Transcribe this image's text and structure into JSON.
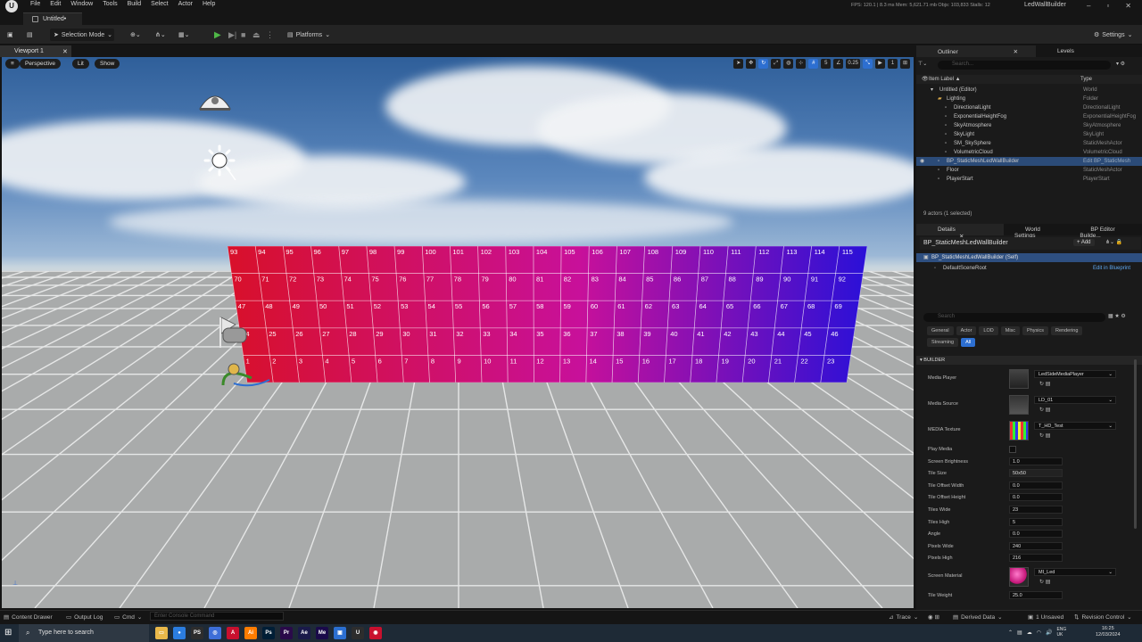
{
  "menubar": {
    "items": [
      "File",
      "Edit",
      "Window",
      "Tools",
      "Build",
      "Select",
      "Actor",
      "Help"
    ],
    "stats": "FPS: 120.1  |  8.3 ms  Mem: 5,621.71 mb  Objs: 103,833  Stalls: 12",
    "project": "LedWallBuilder",
    "logo": "U"
  },
  "tab": {
    "title": "Untitled•"
  },
  "toolbar": {
    "selection_mode": "Selection Mode",
    "platforms": "Platforms",
    "settings": "Settings"
  },
  "viewport": {
    "tab": "Viewport 1",
    "perspective": "Perspective",
    "lit": "Lit",
    "show": "Show",
    "grid_size": "5",
    "angle": "0.25",
    "cam_speed": "1"
  },
  "ledwall": {
    "rows": [
      [
        93,
        94,
        95,
        96,
        97,
        98,
        99,
        100,
        101,
        102,
        103,
        104,
        105,
        106,
        107,
        108,
        109,
        110,
        111,
        112,
        113,
        114,
        115
      ],
      [
        70,
        71,
        72,
        73,
        74,
        75,
        76,
        77,
        78,
        79,
        80,
        81,
        82,
        83,
        84,
        85,
        86,
        87,
        88,
        89,
        90,
        91,
        92
      ],
      [
        47,
        48,
        49,
        50,
        51,
        52,
        53,
        54,
        55,
        56,
        57,
        58,
        59,
        60,
        61,
        62,
        63,
        64,
        65,
        66,
        67,
        68,
        69
      ],
      [
        24,
        25,
        26,
        27,
        28,
        29,
        30,
        31,
        32,
        33,
        34,
        35,
        36,
        37,
        38,
        39,
        40,
        41,
        42,
        43,
        44,
        45,
        46
      ],
      [
        1,
        2,
        3,
        4,
        5,
        6,
        7,
        8,
        9,
        10,
        11,
        12,
        13,
        14,
        15,
        16,
        17,
        18,
        19,
        20,
        21,
        22,
        23
      ]
    ],
    "color_left": "#d8102a",
    "color_mid": "#c8109a",
    "color_right": "#2a10d8"
  },
  "outliner": {
    "tab": "Outliner",
    "tab2": "Levels",
    "search": "Search...",
    "col_label": "Item Label ▲",
    "col_type": "Type",
    "items": [
      {
        "label": "Untitled (Editor)",
        "type": "World",
        "indent": 0
      },
      {
        "label": "Lighting",
        "type": "Folder",
        "indent": 1
      },
      {
        "label": "DirectionalLight",
        "type": "DirectionalLight",
        "indent": 2
      },
      {
        "label": "ExponentialHeightFog",
        "type": "ExponentialHeightFog",
        "indent": 2
      },
      {
        "label": "SkyAtmosphere",
        "type": "SkyAtmosphere",
        "indent": 2
      },
      {
        "label": "SkyLight",
        "type": "SkyLight",
        "indent": 2
      },
      {
        "label": "SM_SkySphere",
        "type": "StaticMeshActor",
        "indent": 2
      },
      {
        "label": "VolumetricCloud",
        "type": "VolumetricCloud",
        "indent": 2
      },
      {
        "label": "BP_StaticMeshLedWallBuilder",
        "type": "Edit BP_StaticMesh",
        "indent": 1,
        "selected": true
      },
      {
        "label": "Floor",
        "type": "StaticMeshActor",
        "indent": 1
      },
      {
        "label": "PlayerStart",
        "type": "PlayerStart",
        "indent": 1
      }
    ],
    "footer": "9 actors (1 selected)"
  },
  "details": {
    "tab": "Details",
    "tab2": "World Settings",
    "tab3": "BP Editor Builde...",
    "actor": "BP_StaticMeshLedWallBuilder",
    "add": "+ Add",
    "self": "BP_StaticMeshLedWallBuilder (Self)",
    "root": "DefaultSceneRoot",
    "edit_bp": "Edit in Blueprint",
    "search": "Search",
    "categories": [
      "General",
      "Actor",
      "LOD",
      "Misc",
      "Physics",
      "Rendering",
      "Streaming",
      "All"
    ],
    "section": "BUILDER",
    "assets": [
      {
        "label": "Media Player",
        "value": "LedSideMediaPlayer"
      },
      {
        "label": "Media Source",
        "value": "LD_01"
      },
      {
        "label": "MEDIA Texture",
        "value": "T_HD_Test"
      }
    ],
    "props": [
      {
        "label": "Play Media",
        "value": ""
      },
      {
        "label": "Screen Brightness",
        "value": "1.0"
      },
      {
        "label": "Tile Size",
        "value": "50x50"
      },
      {
        "label": "Tile Offset Width",
        "value": "0.0"
      },
      {
        "label": "Tile Offset Height",
        "value": "0.0"
      },
      {
        "label": "Tiles Wide",
        "value": "23"
      },
      {
        "label": "Tiles High",
        "value": "5"
      },
      {
        "label": "Angle",
        "value": "0.0"
      },
      {
        "label": "Pixels Wide",
        "value": "240"
      },
      {
        "label": "Pixels High",
        "value": "216"
      }
    ],
    "material": {
      "label": "Screen Material",
      "value": "MI_Led"
    },
    "tile_weight": {
      "label": "Tile Weight",
      "value": "25.0"
    }
  },
  "bottombar": {
    "content_drawer": "Content Drawer",
    "output_log": "Output Log",
    "cmd": "Cmd",
    "console_placeholder": "Enter Console Command",
    "trace": "Trace",
    "derived": "Derived Data",
    "unsaved": "1 Unsaved",
    "revision": "Revision Control"
  },
  "taskbar": {
    "search": "Type here to search",
    "time": "16:25",
    "date": "12/03/2024",
    "lang": "ENG\nUK",
    "apps": [
      {
        "t": "▭",
        "c": "#e8b84a"
      },
      {
        "t": "●",
        "c": "#2b7de0"
      },
      {
        "t": "PS",
        "c": "#2d2d2d"
      },
      {
        "t": "◎",
        "c": "#3d6ed8"
      },
      {
        "t": "A",
        "c": "#c8102e"
      },
      {
        "t": "Ai",
        "c": "#ff7c00"
      },
      {
        "t": "Ps",
        "c": "#001e36"
      },
      {
        "t": "Pr",
        "c": "#2a0a4a"
      },
      {
        "t": "Ae",
        "c": "#1a1a4a"
      },
      {
        "t": "Me",
        "c": "#1a0a4a"
      },
      {
        "t": "▣",
        "c": "#2b6fd1"
      },
      {
        "t": "U",
        "c": "#2d2d2d"
      },
      {
        "t": "◉",
        "c": "#c8102e"
      }
    ]
  }
}
